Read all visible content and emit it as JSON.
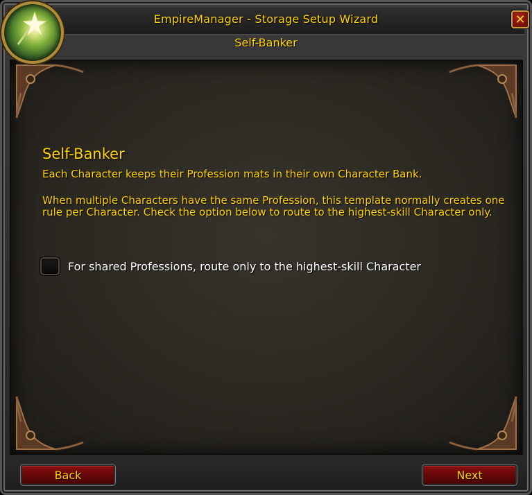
{
  "window": {
    "title": "EmpireManager - Storage Setup Wizard",
    "subtitle": "Self-Banker",
    "close_glyph": "✕",
    "portrait_icon": "star-wand-icon"
  },
  "main": {
    "section_title": "Self-Banker",
    "description_1": "Each Character keeps their Profession mats in their own Character Bank.",
    "description_2": "When multiple Characters have the same Profession, this template normally creates one rule per Character. Check the option below to route to the highest-skill Character only.",
    "option": {
      "label": "For shared Professions, route only to the highest-skill Character",
      "checked": false
    }
  },
  "footer": {
    "back_label": "Back",
    "next_label": "Next"
  },
  "colors": {
    "gold_text": "#ffd100",
    "button_red": "#6a0808"
  }
}
